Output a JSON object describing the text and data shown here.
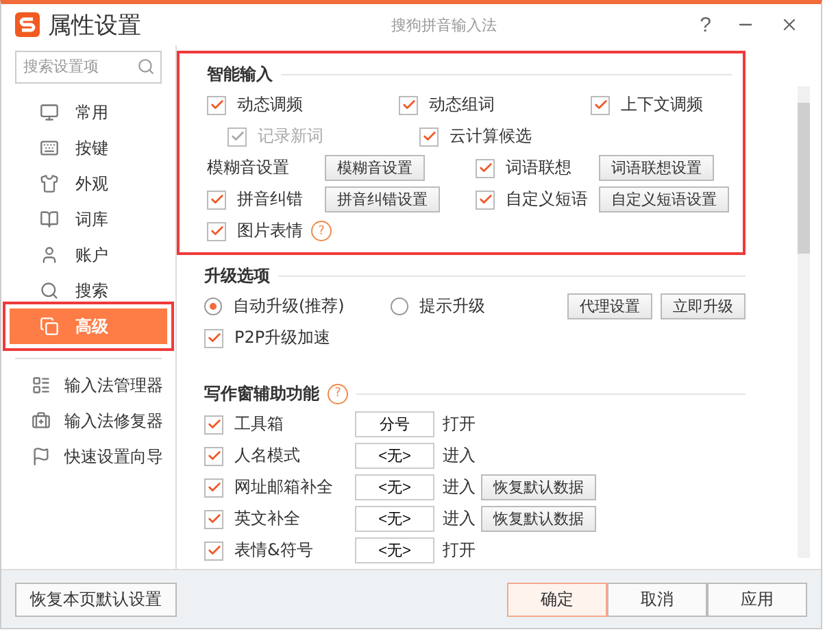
{
  "window": {
    "title": "属性设置",
    "subtitle": "搜狗拼音输入法",
    "help": "?"
  },
  "sidebar": {
    "search": {
      "placeholder": "搜索设置项"
    },
    "items": [
      {
        "label": "常用",
        "selected": false,
        "highlighted": false
      },
      {
        "label": "按键",
        "selected": false,
        "highlighted": false
      },
      {
        "label": "外观",
        "selected": false,
        "highlighted": false
      },
      {
        "label": "词库",
        "selected": false,
        "highlighted": false
      },
      {
        "label": "账户",
        "selected": false,
        "highlighted": false
      },
      {
        "label": "搜索",
        "selected": false,
        "highlighted": false
      },
      {
        "label": "高级",
        "selected": true,
        "highlighted": true
      }
    ],
    "tools": [
      {
        "label": "输入法管理器"
      },
      {
        "label": "输入法修复器"
      },
      {
        "label": "快速设置向导"
      }
    ]
  },
  "smart_input": {
    "title": "智能输入",
    "highlighted": true,
    "row_1": [
      {
        "label": "动态调频",
        "checked": true,
        "disabled": false
      },
      {
        "label": "动态组词",
        "checked": true,
        "disabled": false
      },
      {
        "label": "上下文调频",
        "checked": true,
        "disabled": false
      }
    ],
    "row_2": [
      {
        "label": "记录新词",
        "checked": true,
        "disabled": true
      },
      {
        "label": "云计算候选",
        "checked": true,
        "disabled": false
      }
    ],
    "settings": [
      {
        "kind": "label",
        "label": "模糊音设置",
        "button": "模糊音设置"
      },
      {
        "kind": "check",
        "label": "词语联想",
        "checked": true,
        "button": "词语联想设置"
      },
      {
        "kind": "check",
        "label": "拼音纠错",
        "checked": true,
        "button": "拼音纠错设置"
      },
      {
        "kind": "check",
        "label": "自定义短语",
        "checked": true,
        "button": "自定义短语设置"
      }
    ],
    "emoji": {
      "label": "图片表情",
      "checked": true,
      "help": "?"
    }
  },
  "upgrade": {
    "title": "升级选项",
    "options": [
      {
        "label": "自动升级(推荐)",
        "selected": true
      },
      {
        "label": "提示升级",
        "selected": false
      }
    ],
    "buttons": [
      "代理设置",
      "立即升级"
    ],
    "p2p": {
      "label": "P2P升级加速",
      "checked": true
    }
  },
  "writing_assist": {
    "title": "写作窗辅助功能",
    "help": "?",
    "rows": [
      {
        "label": "工具箱",
        "checked": true,
        "key": "分号",
        "action": "打开"
      },
      {
        "label": "人名模式",
        "checked": true,
        "key": "<无>",
        "action": "进入"
      },
      {
        "label": "网址邮箱补全",
        "checked": true,
        "key": "<无>",
        "action": "进入",
        "button": "恢复默认数据"
      },
      {
        "label": "英文补全",
        "checked": true,
        "key": "<无>",
        "action": "进入",
        "button": "恢复默认数据"
      },
      {
        "label": "表情&符号",
        "checked": true,
        "key": "<无>",
        "action": "打开"
      }
    ]
  },
  "footer": {
    "restore": "恢复本页默认设置",
    "buttons": [
      {
        "label": "确定",
        "primary": true
      },
      {
        "label": "取消",
        "primary": false
      },
      {
        "label": "应用",
        "primary": false
      }
    ]
  }
}
